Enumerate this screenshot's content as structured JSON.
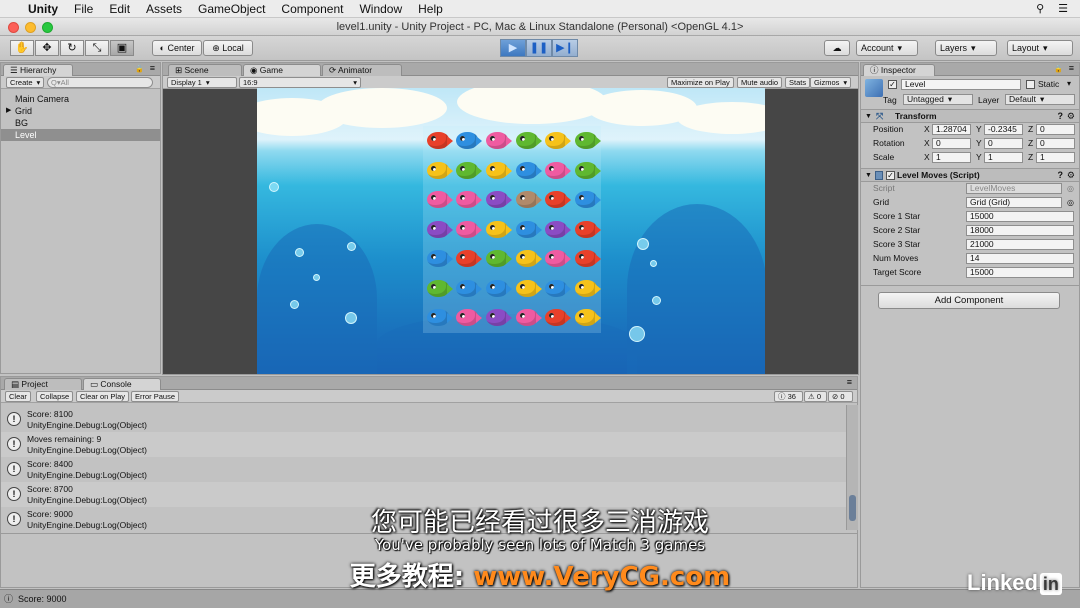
{
  "menubar": {
    "app": "Unity",
    "items": [
      "File",
      "Edit",
      "Assets",
      "GameObject",
      "Component",
      "Window",
      "Help"
    ]
  },
  "window": {
    "title": "level1.unity - Unity Project - PC, Mac & Linux Standalone (Personal) <OpenGL 4.1>"
  },
  "toolbar": {
    "pivot": "Center",
    "space": "Local",
    "account": "Account",
    "layers": "Layers",
    "layout": "Layout",
    "play_icon": "▶",
    "pause_icon": "❚❚",
    "step_icon": "▶❙"
  },
  "hierarchy": {
    "tab": "Hierarchy",
    "create": "Create",
    "search_placeholder": "Q▾All",
    "items": [
      "Main Camera",
      "Grid",
      "BG",
      "Level"
    ],
    "selected": "Level"
  },
  "scene_tabs": {
    "scene": "Scene",
    "game": "Game",
    "animator": "Animator",
    "display": "Display 1",
    "aspect": "16:9",
    "maximize": "Maximize on Play",
    "mute": "Mute audio",
    "stats": "Stats",
    "gizmos": "Gizmos"
  },
  "game_grid": {
    "rows": [
      [
        "red",
        "blue",
        "pink",
        "green",
        "yellow",
        "green"
      ],
      [
        "yellow",
        "green",
        "yellow",
        "blue",
        "pink",
        "green"
      ],
      [
        "pink",
        "pink",
        "purple",
        "bomb",
        "red",
        "blue"
      ],
      [
        "purple",
        "pink",
        "yellow",
        "blue",
        "purple",
        "red"
      ],
      [
        "blue",
        "red",
        "green",
        "yellow",
        "pink",
        "red"
      ],
      [
        "green",
        "blue",
        "blue",
        "yellow",
        "blue",
        "yellow"
      ],
      [
        "blue",
        "pink",
        "purple",
        "pink",
        "red",
        "yellow"
      ]
    ],
    "colors": {
      "red": "#e8402a",
      "blue": "#2e8fe0",
      "pink": "#ef5ba1",
      "green": "#5fb830",
      "yellow": "#f6c21a",
      "purple": "#8b4cc4",
      "bomb": "#b08a6a"
    }
  },
  "inspector": {
    "tab": "Inspector",
    "object_name": "Level",
    "static_label": "Static",
    "tag_label": "Tag",
    "tag_value": "Untagged",
    "layer_label": "Layer",
    "layer_value": "Default",
    "transform": {
      "title": "Transform",
      "position_label": "Position",
      "rotation_label": "Rotation",
      "scale_label": "Scale",
      "position": [
        "1.28704",
        "-0.2345",
        "0"
      ],
      "rotation": [
        "0",
        "0",
        "0"
      ],
      "scale": [
        "1",
        "1",
        "1"
      ],
      "axis_x": "X",
      "axis_y": "Y",
      "axis_z": "Z"
    },
    "level_moves": {
      "title": "Level Moves (Script)",
      "fields": [
        {
          "label": "Script",
          "value": "LevelMoves"
        },
        {
          "label": "Grid",
          "value": "Grid (Grid)"
        },
        {
          "label": "Score 1 Star",
          "value": "15000"
        },
        {
          "label": "Score 2 Star",
          "value": "18000"
        },
        {
          "label": "Score 3 Star",
          "value": "21000"
        },
        {
          "label": "Num Moves",
          "value": "14"
        },
        {
          "label": "Target Score",
          "value": "15000"
        }
      ]
    },
    "add_component": "Add Component"
  },
  "console": {
    "tab_project": "Project",
    "tab_console": "Console",
    "clear": "Clear",
    "collapse": "Collapse",
    "clear_on_play": "Clear on Play",
    "error_pause": "Error Pause",
    "count_log": "36",
    "count_warn": "0",
    "count_error": "0",
    "entries": [
      {
        "line1": "Score: 8100",
        "line2": "UnityEngine.Debug:Log(Object)"
      },
      {
        "line1": "Moves remaining: 9",
        "line2": "UnityEngine.Debug:Log(Object)"
      },
      {
        "line1": "Score: 8400",
        "line2": "UnityEngine.Debug:Log(Object)"
      },
      {
        "line1": "Score: 8700",
        "line2": "UnityEngine.Debug:Log(Object)"
      },
      {
        "line1": "Score: 9000",
        "line2": "UnityEngine.Debug:Log(Object)"
      }
    ]
  },
  "statusbar": {
    "text": "Score: 9000"
  },
  "subtitles": {
    "chinese": "您可能已经看过很多三消游戏",
    "english": "You've probably seen lots of Match 3 games",
    "promo_prefix": "更多教程: ",
    "promo_url": "www.VeryCG.com"
  },
  "watermark": {
    "brand": "Linked",
    "in": "in"
  }
}
